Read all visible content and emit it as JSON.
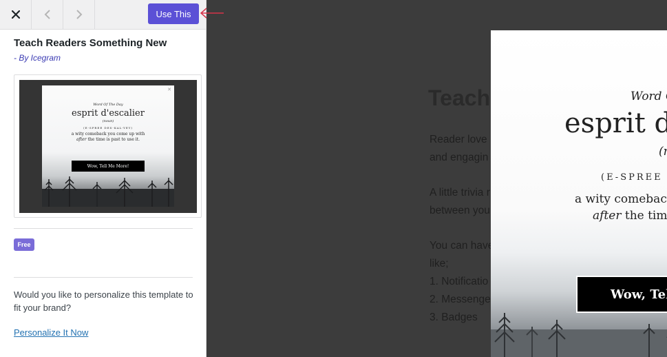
{
  "toolbar": {
    "close_icon": "close-icon",
    "prev_icon": "chevron-left-icon",
    "next_icon": "chevron-right-icon",
    "use_label": "Use This"
  },
  "template": {
    "title": "Teach Readers Something New",
    "author": "- By Icegram",
    "badge": "Free",
    "personalize_question": "Would you like to personalize this template to fit your brand?",
    "personalize_link": "Personalize It Now"
  },
  "popup": {
    "word_of_day": "Word Of The Day",
    "word": "esprit d'escalier",
    "part_of_speech": "(noun)",
    "pronunciation": "(E-SPREE DES-KAL-YEY)",
    "definition_line1": "a wity comeback you come up with",
    "definition_after": "after",
    "definition_line2_rest": " the time is past to use it.",
    "cta": "Wow, Tell Me More!"
  },
  "preview_popup": {
    "word_of_day": "Word O",
    "word": "esprit d",
    "part_of_speech": "(n",
    "pronunciation": "(E-SPREE D",
    "definition_line1": "a wity comeback",
    "definition_after": "after",
    "definition_line2_rest": " the time",
    "cta": "Wow, Tel"
  },
  "background_page": {
    "heading": "Teach",
    "lines": [
      "Reader love",
      "and engagin",
      "A little trivia r",
      "between you",
      "You can have",
      "like;",
      "1. Notificatio",
      "2. Messenge",
      "3. Badges"
    ]
  },
  "colors": {
    "accent": "#5b50d6",
    "badge": "#7a6cd8",
    "link": "#2271b1",
    "annotation_arrow": "#d6334a"
  }
}
